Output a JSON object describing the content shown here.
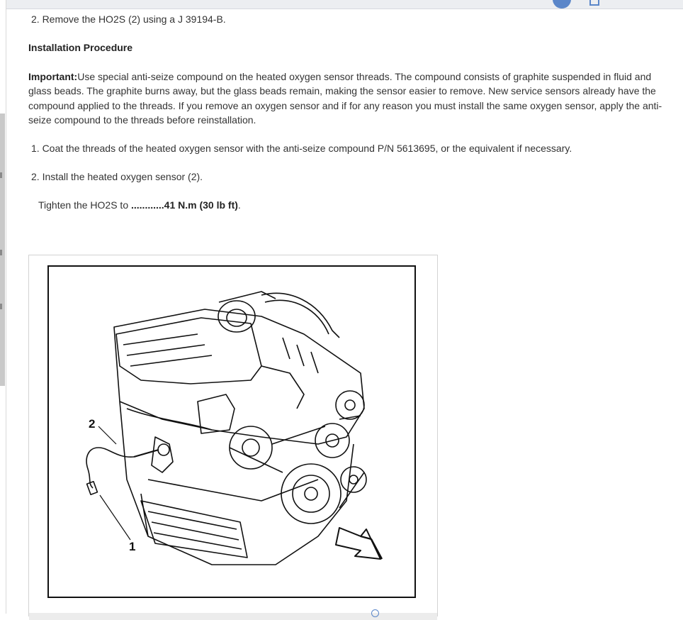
{
  "steps_top": {
    "remove_step": "2. Remove the HO2S (2) using a J 39194-B."
  },
  "installation": {
    "heading": "Installation Procedure",
    "important_label": "Important:",
    "important_text": "Use special anti-seize compound on the heated oxygen sensor threads. The compound consists of graphite suspended in fluid and glass beads. The graphite burns away, but the glass beads remain, making the sensor easier to remove. New service sensors already have the compound applied to the threads. If you remove an oxygen sensor and if for any reason you must install the same oxygen sensor, apply the anti-seize compound to the threads before reinstallation.",
    "step1": "1. Coat the threads of the heated oxygen sensor with the anti-seize compound P/N 5613695, or the equivalent if necessary.",
    "step2": "2. Install the heated oxygen sensor (2).",
    "torque_prefix": "Tighten the HO2S to ",
    "torque_value": "............41 N.m (30 lb ft)",
    "torque_suffix": "."
  },
  "figure": {
    "callout_1": "1",
    "callout_2": "2"
  }
}
